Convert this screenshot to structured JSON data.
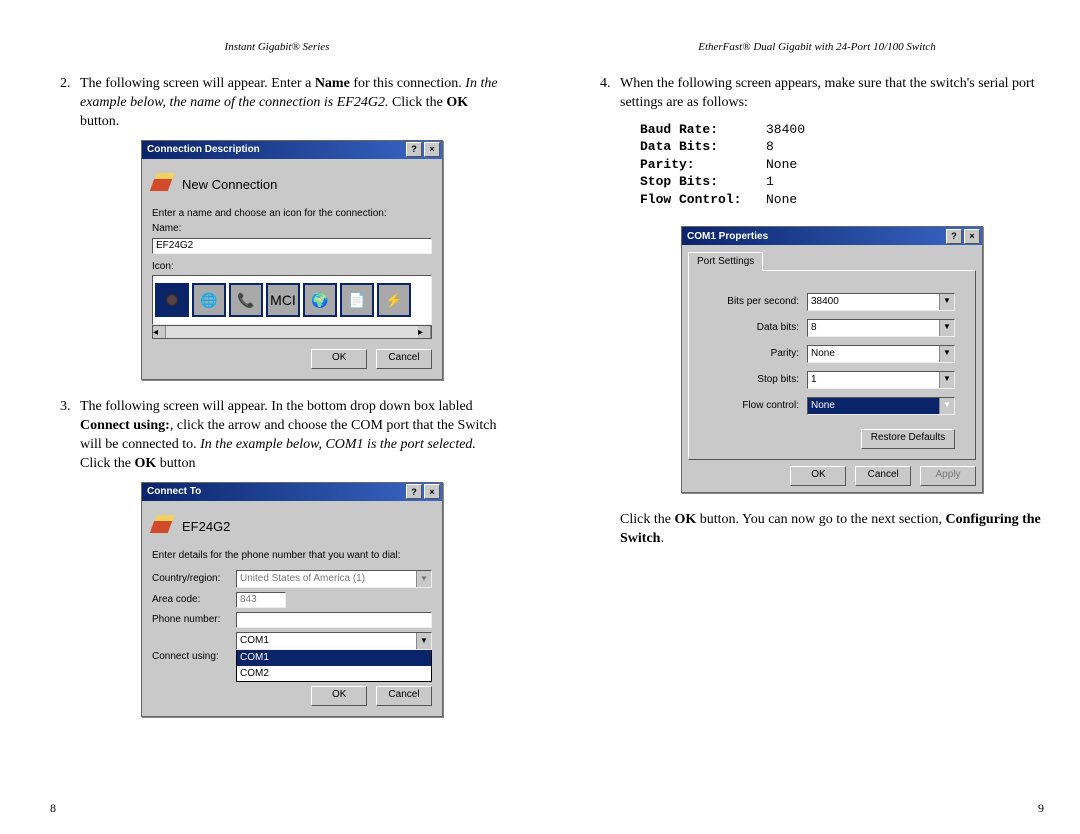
{
  "left": {
    "running_head": "Instant Gigabit® Series",
    "page_num": "8",
    "step2": {
      "lead_in": "The following screen will appear.  Enter a ",
      "bold1": "Name",
      "after_name": " for this connection.  ",
      "italic": "In the example below, the name of the connection is EF24G2.",
      "click": "  Click the ",
      "bold2": "OK",
      "button_word": " button."
    },
    "dlg1": {
      "title": "Connection Description",
      "header": "New Connection",
      "prompt": "Enter a name and choose an icon for the connection:",
      "name_label": "Name:",
      "name_value": "EF24G2",
      "icon_label": "Icon:",
      "ok": "OK",
      "cancel": "Cancel"
    },
    "step3": {
      "line1": "The following screen will appear.  In the bottom drop down box labled ",
      "bold1": "Connect using:",
      "after1": ", click the arrow and choose the COM port that the Switch will be connected to.  ",
      "italic": "In the example below, COM1 is the port selected.",
      "click": "  Click the ",
      "bold2": "OK",
      "tail": " button"
    },
    "dlg2": {
      "title": "Connect To",
      "conn_name": "EF24G2",
      "prompt": "Enter details for the phone number that you want to dial:",
      "country_label": "Country/region:",
      "country_value": "United States of America (1)",
      "area_label": "Area code:",
      "area_value": "843",
      "phone_label": "Phone number:",
      "phone_value": "",
      "connect_label": "Connect using:",
      "connect_value": "COM1",
      "options": [
        "COM1",
        "COM2"
      ],
      "ok": "OK",
      "cancel": "Cancel"
    }
  },
  "right": {
    "running_head": "EtherFast® Dual Gigabit with 24-Port 10/100 Switch",
    "page_num": "9",
    "step4": {
      "text": "When the following screen appears, make sure that the switch's serial port settings are as follows:"
    },
    "specs": {
      "baud_k": "Baud Rate:",
      "baud_v": "38400",
      "data_k": "Data Bits:",
      "data_v": "8",
      "parity_k": "Parity:",
      "parity_v": "None",
      "stop_k": "Stop Bits:",
      "stop_v": "1",
      "flow_k": "Flow Control:",
      "flow_v": "None"
    },
    "dlg3": {
      "title": "COM1 Properties",
      "tab": "Port Settings",
      "bps_label": "Bits per second:",
      "bps_value": "38400",
      "db_label": "Data bits:",
      "db_value": "8",
      "par_label": "Parity:",
      "par_value": "None",
      "sb_label": "Stop bits:",
      "sb_value": "1",
      "fc_label": "Flow control:",
      "fc_value": "None",
      "restore": "Restore Defaults",
      "ok": "OK",
      "cancel": "Cancel",
      "apply": "Apply"
    },
    "closing": {
      "a": "Click the ",
      "ok": "OK",
      "b": " button.  You can now go to the next section, ",
      "cfg": "Configuring the Switch",
      "c": "."
    }
  }
}
